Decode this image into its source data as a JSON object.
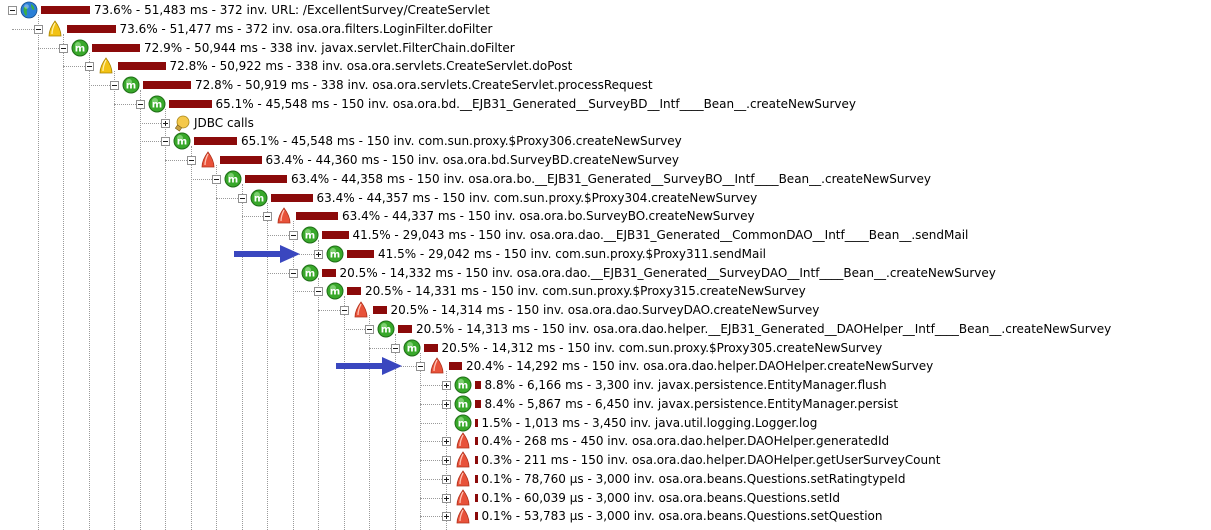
{
  "tree": {
    "rows": [
      {
        "depth": 0,
        "icon": "globe",
        "toggle": "minus",
        "bar": 0.736,
        "label": "73.6% - 51,483 ms - 372 inv. URL: /ExcellentSurvey/CreateServlet"
      },
      {
        "depth": 1,
        "icon": "yellow-cone",
        "toggle": "minus",
        "bar": 0.736,
        "label": "73.6% - 51,477 ms - 372 inv. osa.ora.filters.LoginFilter.doFilter"
      },
      {
        "depth": 2,
        "icon": "green-m",
        "toggle": "minus",
        "bar": 0.729,
        "label": "72.9% - 50,944 ms - 338 inv. javax.servlet.FilterChain.doFilter"
      },
      {
        "depth": 3,
        "icon": "yellow-cone",
        "toggle": "minus",
        "bar": 0.728,
        "label": "72.8% - 50,922 ms - 338 inv. osa.ora.servlets.CreateServlet.doPost"
      },
      {
        "depth": 4,
        "icon": "green-m",
        "toggle": "minus",
        "bar": 0.728,
        "label": "72.8% - 50,919 ms - 338 inv. osa.ora.servlets.CreateServlet.processRequest"
      },
      {
        "depth": 5,
        "icon": "green-m",
        "toggle": "minus",
        "bar": 0.651,
        "label": "65.1% - 45,548 ms - 150 inv. osa.ora.bd.__EJB31_Generated__SurveyBD__Intf____Bean__.createNewSurvey"
      },
      {
        "depth": 6,
        "icon": "jdbc-bulb",
        "toggle": "plus",
        "bar": 0,
        "label": "JDBC calls"
      },
      {
        "depth": 6,
        "icon": "green-m",
        "toggle": "minus",
        "bar": 0.651,
        "label": "65.1% - 45,548 ms - 150 inv. com.sun.proxy.$Proxy306.createNewSurvey"
      },
      {
        "depth": 7,
        "icon": "orange-cone",
        "toggle": "minus",
        "bar": 0.634,
        "label": "63.4% - 44,360 ms - 150 inv. osa.ora.bd.SurveyBD.createNewSurvey"
      },
      {
        "depth": 8,
        "icon": "green-m",
        "toggle": "minus",
        "bar": 0.634,
        "label": "63.4% - 44,358 ms - 150 inv. osa.ora.bo.__EJB31_Generated__SurveyBO__Intf____Bean__.createNewSurvey"
      },
      {
        "depth": 9,
        "icon": "green-m",
        "toggle": "minus",
        "bar": 0.634,
        "label": "63.4% - 44,357 ms - 150 inv. com.sun.proxy.$Proxy304.createNewSurvey"
      },
      {
        "depth": 10,
        "icon": "orange-cone",
        "toggle": "minus",
        "bar": 0.634,
        "label": "63.4% - 44,337 ms - 150 inv. osa.ora.bo.SurveyBO.createNewSurvey"
      },
      {
        "depth": 11,
        "icon": "green-m",
        "toggle": "minus",
        "bar": 0.415,
        "label": "41.5% - 29,043 ms - 150 inv. osa.ora.dao.__EJB31_Generated__CommonDAO__Intf____Bean__.sendMail"
      },
      {
        "depth": 12,
        "icon": "green-m",
        "toggle": "plus",
        "bar": 0.415,
        "label": "41.5% - 29,042 ms - 150 inv. com.sun.proxy.$Proxy311.sendMail"
      },
      {
        "depth": 11,
        "icon": "green-m",
        "toggle": "minus",
        "bar": 0.205,
        "label": "20.5% - 14,332 ms - 150 inv. osa.ora.dao.__EJB31_Generated__SurveyDAO__Intf____Bean__.createNewSurvey"
      },
      {
        "depth": 12,
        "icon": "green-m",
        "toggle": "minus",
        "bar": 0.205,
        "label": "20.5% - 14,331 ms - 150 inv. com.sun.proxy.$Proxy315.createNewSurvey"
      },
      {
        "depth": 13,
        "icon": "orange-cone",
        "toggle": "minus",
        "bar": 0.205,
        "label": "20.5% - 14,314 ms - 150 inv. osa.ora.dao.SurveyDAO.createNewSurvey"
      },
      {
        "depth": 14,
        "icon": "green-m",
        "toggle": "minus",
        "bar": 0.205,
        "label": "20.5% - 14,313 ms - 150 inv. osa.ora.dao.helper.__EJB31_Generated__DAOHelper__Intf____Bean__.createNewSurvey"
      },
      {
        "depth": 15,
        "icon": "green-m",
        "toggle": "minus",
        "bar": 0.205,
        "label": "20.5% - 14,312 ms - 150 inv. com.sun.proxy.$Proxy305.createNewSurvey"
      },
      {
        "depth": 16,
        "icon": "orange-cone",
        "toggle": "minus",
        "bar": 0.204,
        "label": "20.4% - 14,292 ms - 150 inv. osa.ora.dao.helper.DAOHelper.createNewSurvey"
      },
      {
        "depth": 17,
        "icon": "green-m",
        "toggle": "plus",
        "bar": 0.088,
        "label": "8.8% - 6,166 ms - 3,300 inv. javax.persistence.EntityManager.flush"
      },
      {
        "depth": 17,
        "icon": "green-m",
        "toggle": "plus",
        "bar": 0.084,
        "label": "8.4% - 5,867 ms - 6,450 inv. javax.persistence.EntityManager.persist"
      },
      {
        "depth": 17,
        "icon": "green-m",
        "toggle": "none",
        "bar": 0.015,
        "label": "1.5% - 1,013 ms - 3,450 inv. java.util.logging.Logger.log"
      },
      {
        "depth": 17,
        "icon": "orange-cone",
        "toggle": "plus",
        "bar": 0.004,
        "label": "0.4% - 268 ms - 450 inv. osa.ora.dao.helper.DAOHelper.generatedId"
      },
      {
        "depth": 17,
        "icon": "orange-cone",
        "toggle": "plus",
        "bar": 0.003,
        "label": "0.3% - 211 ms - 150 inv. osa.ora.dao.helper.DAOHelper.getUserSurveyCount"
      },
      {
        "depth": 17,
        "icon": "orange-cone",
        "toggle": "plus",
        "bar": 0.001,
        "label": "0.1% - 78,760 µs - 3,000 inv. osa.ora.beans.Questions.setRatingtypeId"
      },
      {
        "depth": 17,
        "icon": "orange-cone",
        "toggle": "plus",
        "bar": 0.001,
        "label": "0.1% - 60,039 µs - 3,000 inv. osa.ora.beans.Questions.setId"
      },
      {
        "depth": 17,
        "icon": "orange-cone",
        "toggle": "plus",
        "bar": 0.001,
        "label": "0.1% - 53,783 µs - 3,000 inv. osa.ora.beans.Questions.setQuestion"
      }
    ],
    "arrows": [
      {
        "name": "arrow-pointing-sendmail",
        "row": 13,
        "color": "#3a47bf"
      },
      {
        "name": "arrow-pointing-daohelper",
        "row": 19,
        "color": "#3a47bf"
      }
    ],
    "colors": {
      "bar": "#8b0a0a",
      "green_icon": "#38a82a",
      "orange_icon": "#e8523a",
      "yellow_icon": "#f2c214",
      "arrow": "#3a47bf"
    }
  }
}
